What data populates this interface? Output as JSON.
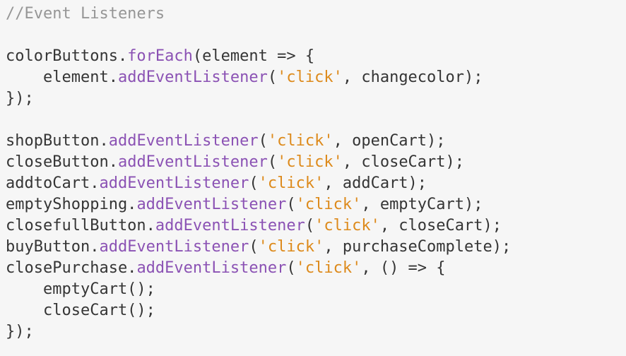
{
  "editor": {
    "language": "javascript",
    "colors": {
      "background": "#f6f6f6",
      "plain": "#353535",
      "comment": "#969696",
      "method": "#8b52b4",
      "string": "#dd8a1b"
    },
    "lines": [
      [
        {
          "t": "comment",
          "v": "//Event Listeners"
        }
      ],
      [],
      [
        {
          "t": "plain",
          "v": "colorButtons."
        },
        {
          "t": "method",
          "v": "forEach"
        },
        {
          "t": "plain",
          "v": "(element => {"
        }
      ],
      [
        {
          "t": "plain",
          "v": "    element."
        },
        {
          "t": "method",
          "v": "addEventListener"
        },
        {
          "t": "plain",
          "v": "("
        },
        {
          "t": "string",
          "v": "'click'"
        },
        {
          "t": "plain",
          "v": ", changecolor);"
        }
      ],
      [
        {
          "t": "plain",
          "v": "});"
        }
      ],
      [],
      [
        {
          "t": "plain",
          "v": "shopButton."
        },
        {
          "t": "method",
          "v": "addEventListener"
        },
        {
          "t": "plain",
          "v": "("
        },
        {
          "t": "string",
          "v": "'click'"
        },
        {
          "t": "plain",
          "v": ", openCart);"
        }
      ],
      [
        {
          "t": "plain",
          "v": "closeButton."
        },
        {
          "t": "method",
          "v": "addEventListener"
        },
        {
          "t": "plain",
          "v": "("
        },
        {
          "t": "string",
          "v": "'click'"
        },
        {
          "t": "plain",
          "v": ", closeCart);"
        }
      ],
      [
        {
          "t": "plain",
          "v": "addtoCart."
        },
        {
          "t": "method",
          "v": "addEventListener"
        },
        {
          "t": "plain",
          "v": "("
        },
        {
          "t": "string",
          "v": "'click'"
        },
        {
          "t": "plain",
          "v": ", addCart);"
        }
      ],
      [
        {
          "t": "plain",
          "v": "emptyShopping."
        },
        {
          "t": "method",
          "v": "addEventListener"
        },
        {
          "t": "plain",
          "v": "("
        },
        {
          "t": "string",
          "v": "'click'"
        },
        {
          "t": "plain",
          "v": ", emptyCart);"
        }
      ],
      [
        {
          "t": "plain",
          "v": "closefullButton."
        },
        {
          "t": "method",
          "v": "addEventListener"
        },
        {
          "t": "plain",
          "v": "("
        },
        {
          "t": "string",
          "v": "'click'"
        },
        {
          "t": "plain",
          "v": ", closeCart);"
        }
      ],
      [
        {
          "t": "plain",
          "v": "buyButton."
        },
        {
          "t": "method",
          "v": "addEventListener"
        },
        {
          "t": "plain",
          "v": "("
        },
        {
          "t": "string",
          "v": "'click'"
        },
        {
          "t": "plain",
          "v": ", purchaseComplete);"
        }
      ],
      [
        {
          "t": "plain",
          "v": "closePurchase."
        },
        {
          "t": "method",
          "v": "addEventListener"
        },
        {
          "t": "plain",
          "v": "("
        },
        {
          "t": "string",
          "v": "'click'"
        },
        {
          "t": "plain",
          "v": ", () => {"
        }
      ],
      [
        {
          "t": "plain",
          "v": "    emptyCart();"
        }
      ],
      [
        {
          "t": "plain",
          "v": "    closeCart();"
        }
      ],
      [
        {
          "t": "plain",
          "v": "});"
        }
      ]
    ]
  }
}
